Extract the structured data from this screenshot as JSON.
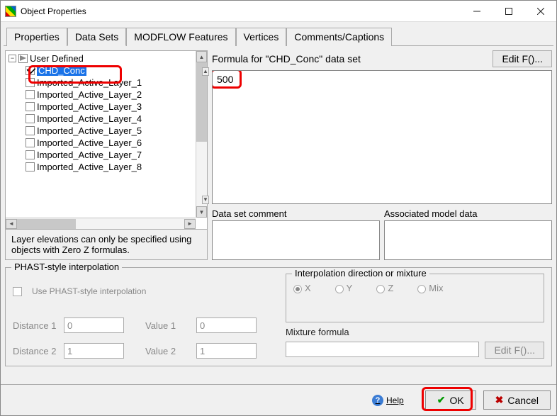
{
  "window": {
    "title": "Object Properties"
  },
  "tabs": {
    "items": [
      "Properties",
      "Data Sets",
      "MODFLOW Features",
      "Vertices",
      "Comments/Captions"
    ],
    "active_index": 1
  },
  "tree": {
    "root_label": "User Defined",
    "root_expanded": true,
    "items": [
      {
        "label": "CHD_Conc",
        "checked": true,
        "selected": true
      },
      {
        "label": "Imported_Active_Layer_1",
        "checked": false
      },
      {
        "label": "Imported_Active_Layer_2",
        "checked": false
      },
      {
        "label": "Imported_Active_Layer_3",
        "checked": false
      },
      {
        "label": "Imported_Active_Layer_4",
        "checked": false
      },
      {
        "label": "Imported_Active_Layer_5",
        "checked": false
      },
      {
        "label": "Imported_Active_Layer_6",
        "checked": false
      },
      {
        "label": "Imported_Active_Layer_7",
        "checked": false
      },
      {
        "label": "Imported_Active_Layer_8",
        "checked": false
      }
    ]
  },
  "layer_note": "Layer elevations can only be specified using objects with Zero Z formulas.",
  "formula": {
    "label": "Formula for \"CHD_Conc\" data set",
    "value": "500",
    "edit_button": "Edit F()..."
  },
  "ds_comment": {
    "header": "Data set comment",
    "value": ""
  },
  "assoc_model": {
    "header": "Associated model data",
    "value": ""
  },
  "phast": {
    "legend": "PHAST-style interpolation",
    "use_label": "Use PHAST-style interpolation",
    "use_checked": false,
    "distance1_label": "Distance 1",
    "distance1_value": "0",
    "value1_label": "Value 1",
    "value1_value": "0",
    "distance2_label": "Distance 2",
    "distance2_value": "1",
    "value2_label": "Value 2",
    "value2_value": "1",
    "interp_dir": {
      "legend": "Interpolation direction or mixture",
      "options": [
        "X",
        "Y",
        "Z",
        "Mix"
      ],
      "selected": "X"
    },
    "mixture_label": "Mixture formula",
    "mixture_value": "",
    "editf_label": "Edit F()..."
  },
  "footer": {
    "help": "Help",
    "ok": "OK",
    "cancel": "Cancel"
  }
}
